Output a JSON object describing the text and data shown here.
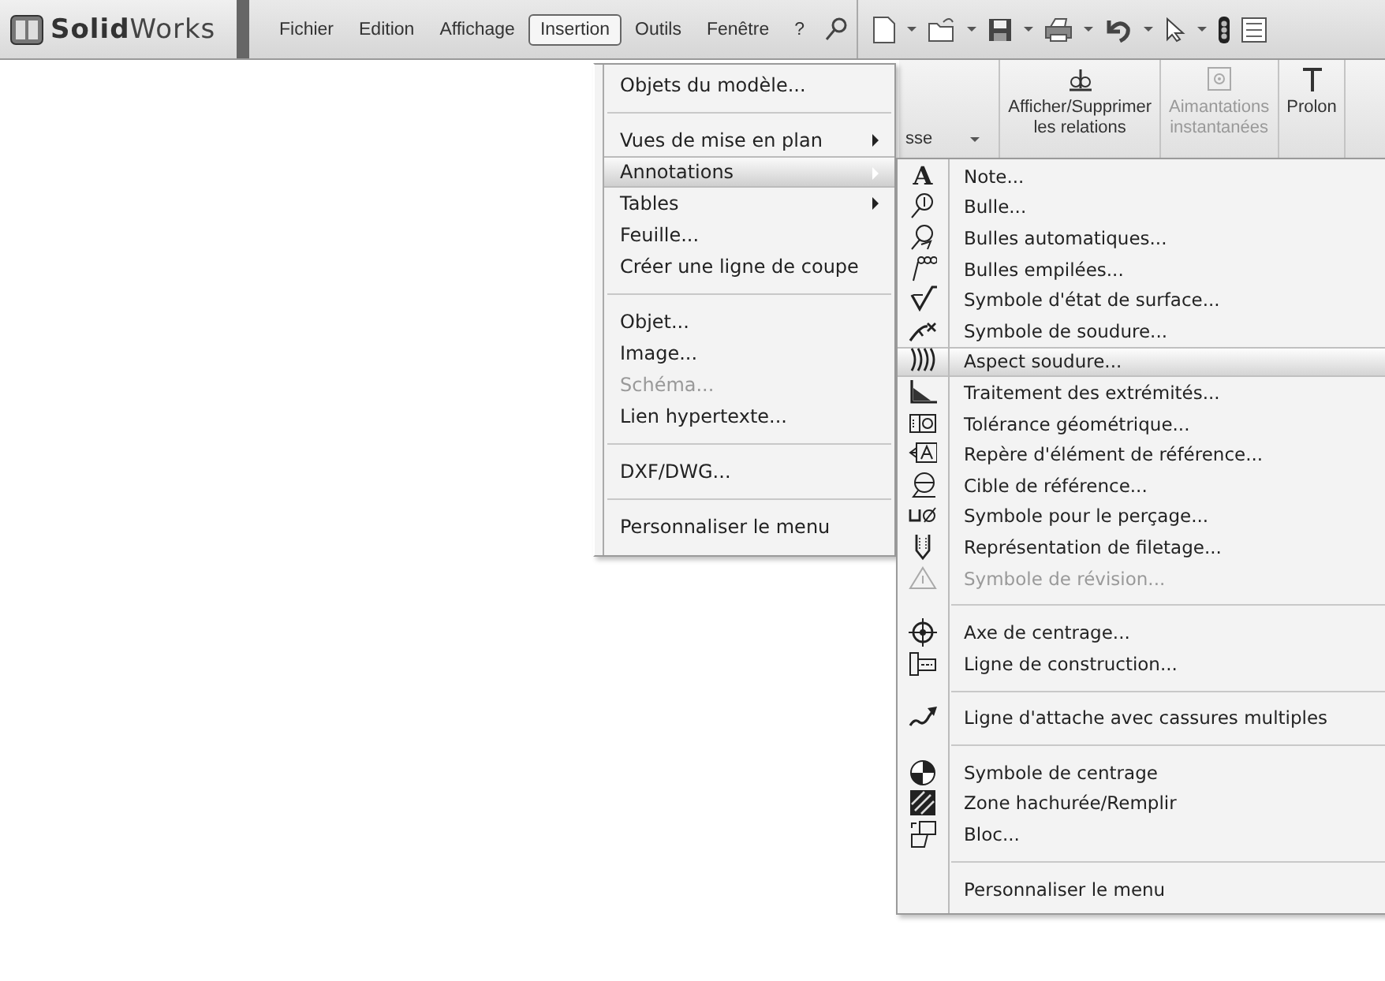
{
  "app": {
    "logo": "**Solid**Works"
  },
  "menu_bar": [
    {
      "label": "Fichier",
      "selected": false
    },
    {
      "label": "Edition",
      "selected": false
    },
    {
      "label": "Affichage",
      "selected": false
    },
    {
      "label": "Insertion",
      "selected": true
    },
    {
      "label": "Outils",
      "selected": false
    },
    {
      "label": "Fenêtre",
      "selected": false
    },
    {
      "label": "?",
      "selected": false
    }
  ],
  "ribbon": [
    {
      "label": "sse",
      "kind": "dropdown",
      "disabled": false
    },
    {
      "label": "Afficher/Supprimer\nles relations",
      "kind": "button",
      "disabled": false
    },
    {
      "label": "Aimantations\ninstantanées",
      "kind": "button",
      "disabled": true
    },
    {
      "label": "Prolon",
      "kind": "button",
      "disabled": false
    }
  ],
  "insert_menu": [
    {
      "kind": "item",
      "label": "Objets du modèle...",
      "submenu": false,
      "disabled": false,
      "selected": false
    },
    {
      "kind": "separator"
    },
    {
      "kind": "item",
      "label": "Vues de mise en plan",
      "submenu": true,
      "disabled": false,
      "selected": false
    },
    {
      "kind": "item",
      "label": "Annotations",
      "submenu": true,
      "disabled": false,
      "selected": true
    },
    {
      "kind": "item",
      "label": "Tables",
      "submenu": true,
      "disabled": false,
      "selected": false
    },
    {
      "kind": "item",
      "label": "Feuille...",
      "submenu": false,
      "disabled": false,
      "selected": false
    },
    {
      "kind": "item",
      "label": "Créer une ligne de coupe",
      "submenu": false,
      "disabled": false,
      "selected": false
    },
    {
      "kind": "separator"
    },
    {
      "kind": "item",
      "label": "Objet...",
      "submenu": false,
      "disabled": false,
      "selected": false
    },
    {
      "kind": "item",
      "label": "Image...",
      "submenu": false,
      "disabled": false,
      "selected": false
    },
    {
      "kind": "item",
      "label": "Schéma...",
      "submenu": false,
      "disabled": true,
      "selected": false
    },
    {
      "kind": "item",
      "label": "Lien hypertexte...",
      "submenu": false,
      "disabled": false,
      "selected": false
    },
    {
      "kind": "separator"
    },
    {
      "kind": "item",
      "label": "DXF/DWG...",
      "submenu": false,
      "disabled": false,
      "selected": false
    },
    {
      "kind": "separator"
    },
    {
      "kind": "item",
      "label": "Personnaliser le menu",
      "submenu": false,
      "disabled": false,
      "selected": false
    }
  ],
  "annotations_menu": [
    {
      "kind": "item",
      "label": "Note...",
      "glyph": "A",
      "disabled": false,
      "selected": false
    },
    {
      "kind": "item",
      "label": "Bulle...",
      "disabled": false,
      "selected": false
    },
    {
      "kind": "item",
      "label": "Bulles automatiques...",
      "disabled": false,
      "selected": false
    },
    {
      "kind": "item",
      "label": "Bulles empilées...",
      "disabled": false,
      "selected": false
    },
    {
      "kind": "item",
      "label": "Symbole d'état de surface...",
      "disabled": false,
      "selected": false
    },
    {
      "kind": "item",
      "label": "Symbole de soudure...",
      "disabled": false,
      "selected": false
    },
    {
      "kind": "item",
      "label": "Aspect soudure...",
      "disabled": false,
      "selected": true
    },
    {
      "kind": "item",
      "label": "Traitement des extrémités...",
      "disabled": false,
      "selected": false
    },
    {
      "kind": "item",
      "label": "Tolérance géométrique...",
      "disabled": false,
      "selected": false
    },
    {
      "kind": "item",
      "label": "Repère d'élément de référence...",
      "disabled": false,
      "selected": false
    },
    {
      "kind": "item",
      "label": "Cible de référence...",
      "disabled": false,
      "selected": false
    },
    {
      "kind": "item",
      "label": "Symbole pour le perçage...",
      "disabled": false,
      "selected": false
    },
    {
      "kind": "item",
      "label": "Représentation de filetage...",
      "disabled": false,
      "selected": false
    },
    {
      "kind": "item",
      "label": "Symbole de révision...",
      "disabled": true,
      "selected": false
    },
    {
      "kind": "separator"
    },
    {
      "kind": "item",
      "label": "Axe de centrage...",
      "disabled": false,
      "selected": false
    },
    {
      "kind": "item",
      "label": "Ligne de construction...",
      "disabled": false,
      "selected": false
    },
    {
      "kind": "separator"
    },
    {
      "kind": "item",
      "label": "Ligne d'attache avec cassures multiples",
      "disabled": false,
      "selected": false
    },
    {
      "kind": "separator"
    },
    {
      "kind": "item",
      "label": "Symbole de centrage",
      "disabled": false,
      "selected": false
    },
    {
      "kind": "item",
      "label": "Zone hachurée/Remplir",
      "disabled": false,
      "selected": false
    },
    {
      "kind": "item",
      "label": "Bloc...",
      "disabled": false,
      "selected": false
    },
    {
      "kind": "separator"
    },
    {
      "kind": "item",
      "label": "Personnaliser le menu",
      "disabled": false,
      "selected": false
    }
  ]
}
